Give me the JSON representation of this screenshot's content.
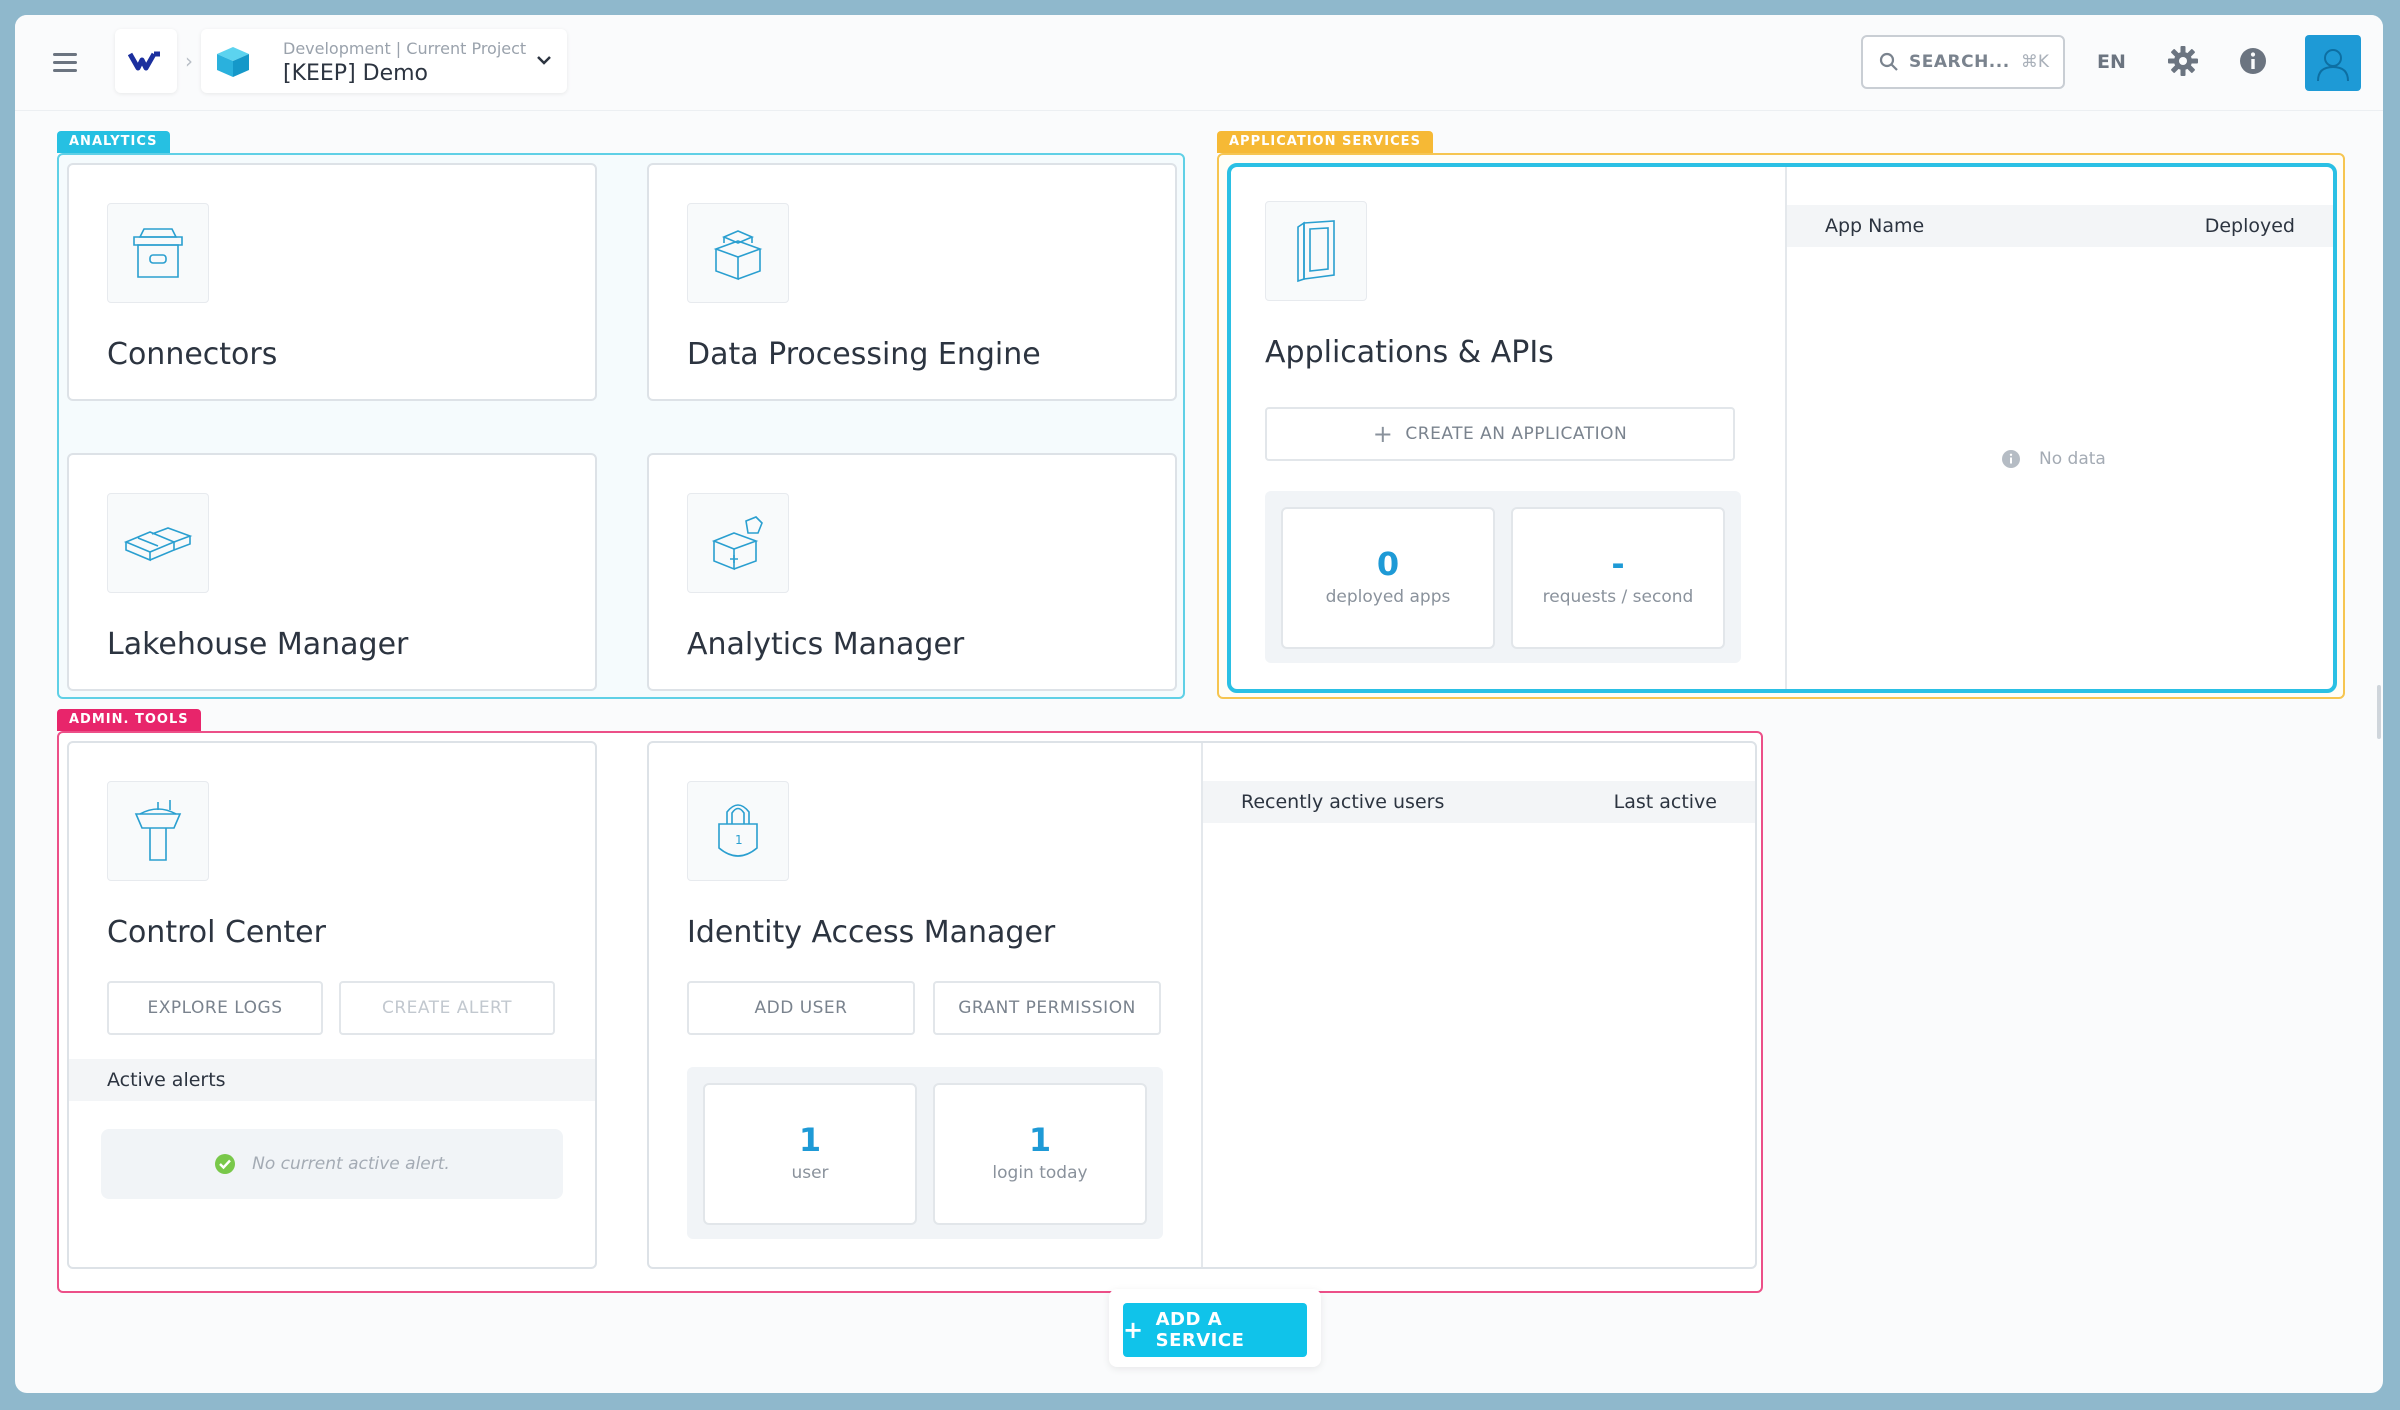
{
  "header": {
    "environment": "Development | Current Project",
    "project": "[KEEP] Demo",
    "search_placeholder": "SEARCH...",
    "search_shortcut": "⌘K",
    "language": "EN"
  },
  "groups": {
    "analytics": "ANALYTICS",
    "app_services": "APPLICATION SERVICES",
    "admin_tools": "ADMIN. TOOLS"
  },
  "analytics": {
    "connectors": "Connectors",
    "dpe": "Data Processing Engine",
    "lakehouse": "Lakehouse Manager",
    "analytics_manager": "Analytics Manager"
  },
  "apps": {
    "title": "Applications & APIs",
    "create_btn": "CREATE AN APPLICATION",
    "stats": [
      {
        "value": "0",
        "label": "deployed apps"
      },
      {
        "value": "-",
        "label": "requests / second"
      }
    ],
    "table": {
      "col1": "App Name",
      "col2": "Deployed",
      "empty": "No data"
    }
  },
  "admin": {
    "control_center": {
      "title": "Control Center",
      "explore_logs": "EXPLORE LOGS",
      "create_alert": "CREATE ALERT",
      "alerts_header": "Active alerts",
      "no_alert": "No current active alert."
    },
    "iam": {
      "title": "Identity Access Manager",
      "add_user": "ADD USER",
      "grant_permission": "GRANT PERMISSION",
      "stats": [
        {
          "value": "1",
          "label": "user"
        },
        {
          "value": "1",
          "label": "login today"
        }
      ],
      "table": {
        "col1": "Recently active users",
        "col2": "Last active"
      }
    }
  },
  "add_service": "ADD A SERVICE",
  "colors": {
    "analytics": "#26c0e2",
    "app_services": "#f6b935",
    "admin_tools": "#e8256b",
    "accent": "#1e9ad6"
  }
}
